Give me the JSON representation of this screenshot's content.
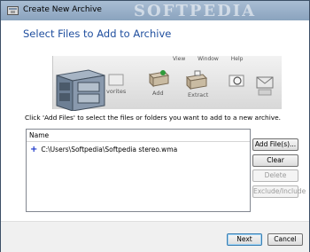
{
  "window": {
    "title": "Create New Archive",
    "watermark": "SOFTPEDIA"
  },
  "heading": "Select Files to Add to Archive",
  "banner": {
    "menu": [
      "View",
      "Window",
      "Help"
    ],
    "labels": [
      "vorites",
      "Add",
      "Extract"
    ]
  },
  "instruction": "Click 'Add Files' to select the files or folders you want to add to a new archive.",
  "file_list": {
    "column_header": "Name",
    "rows": [
      {
        "path": "C:\\Users\\Softpedia\\Softpedia stereo.wma"
      }
    ]
  },
  "buttons": {
    "add_files": "Add File(s)...",
    "clear": "Clear",
    "delete": "Delete",
    "exclude_include": "Exclude/Include",
    "next": "Next",
    "cancel": "Cancel"
  },
  "colors": {
    "heading": "#1f4e9e",
    "accent_plus": "#1a35c9"
  }
}
